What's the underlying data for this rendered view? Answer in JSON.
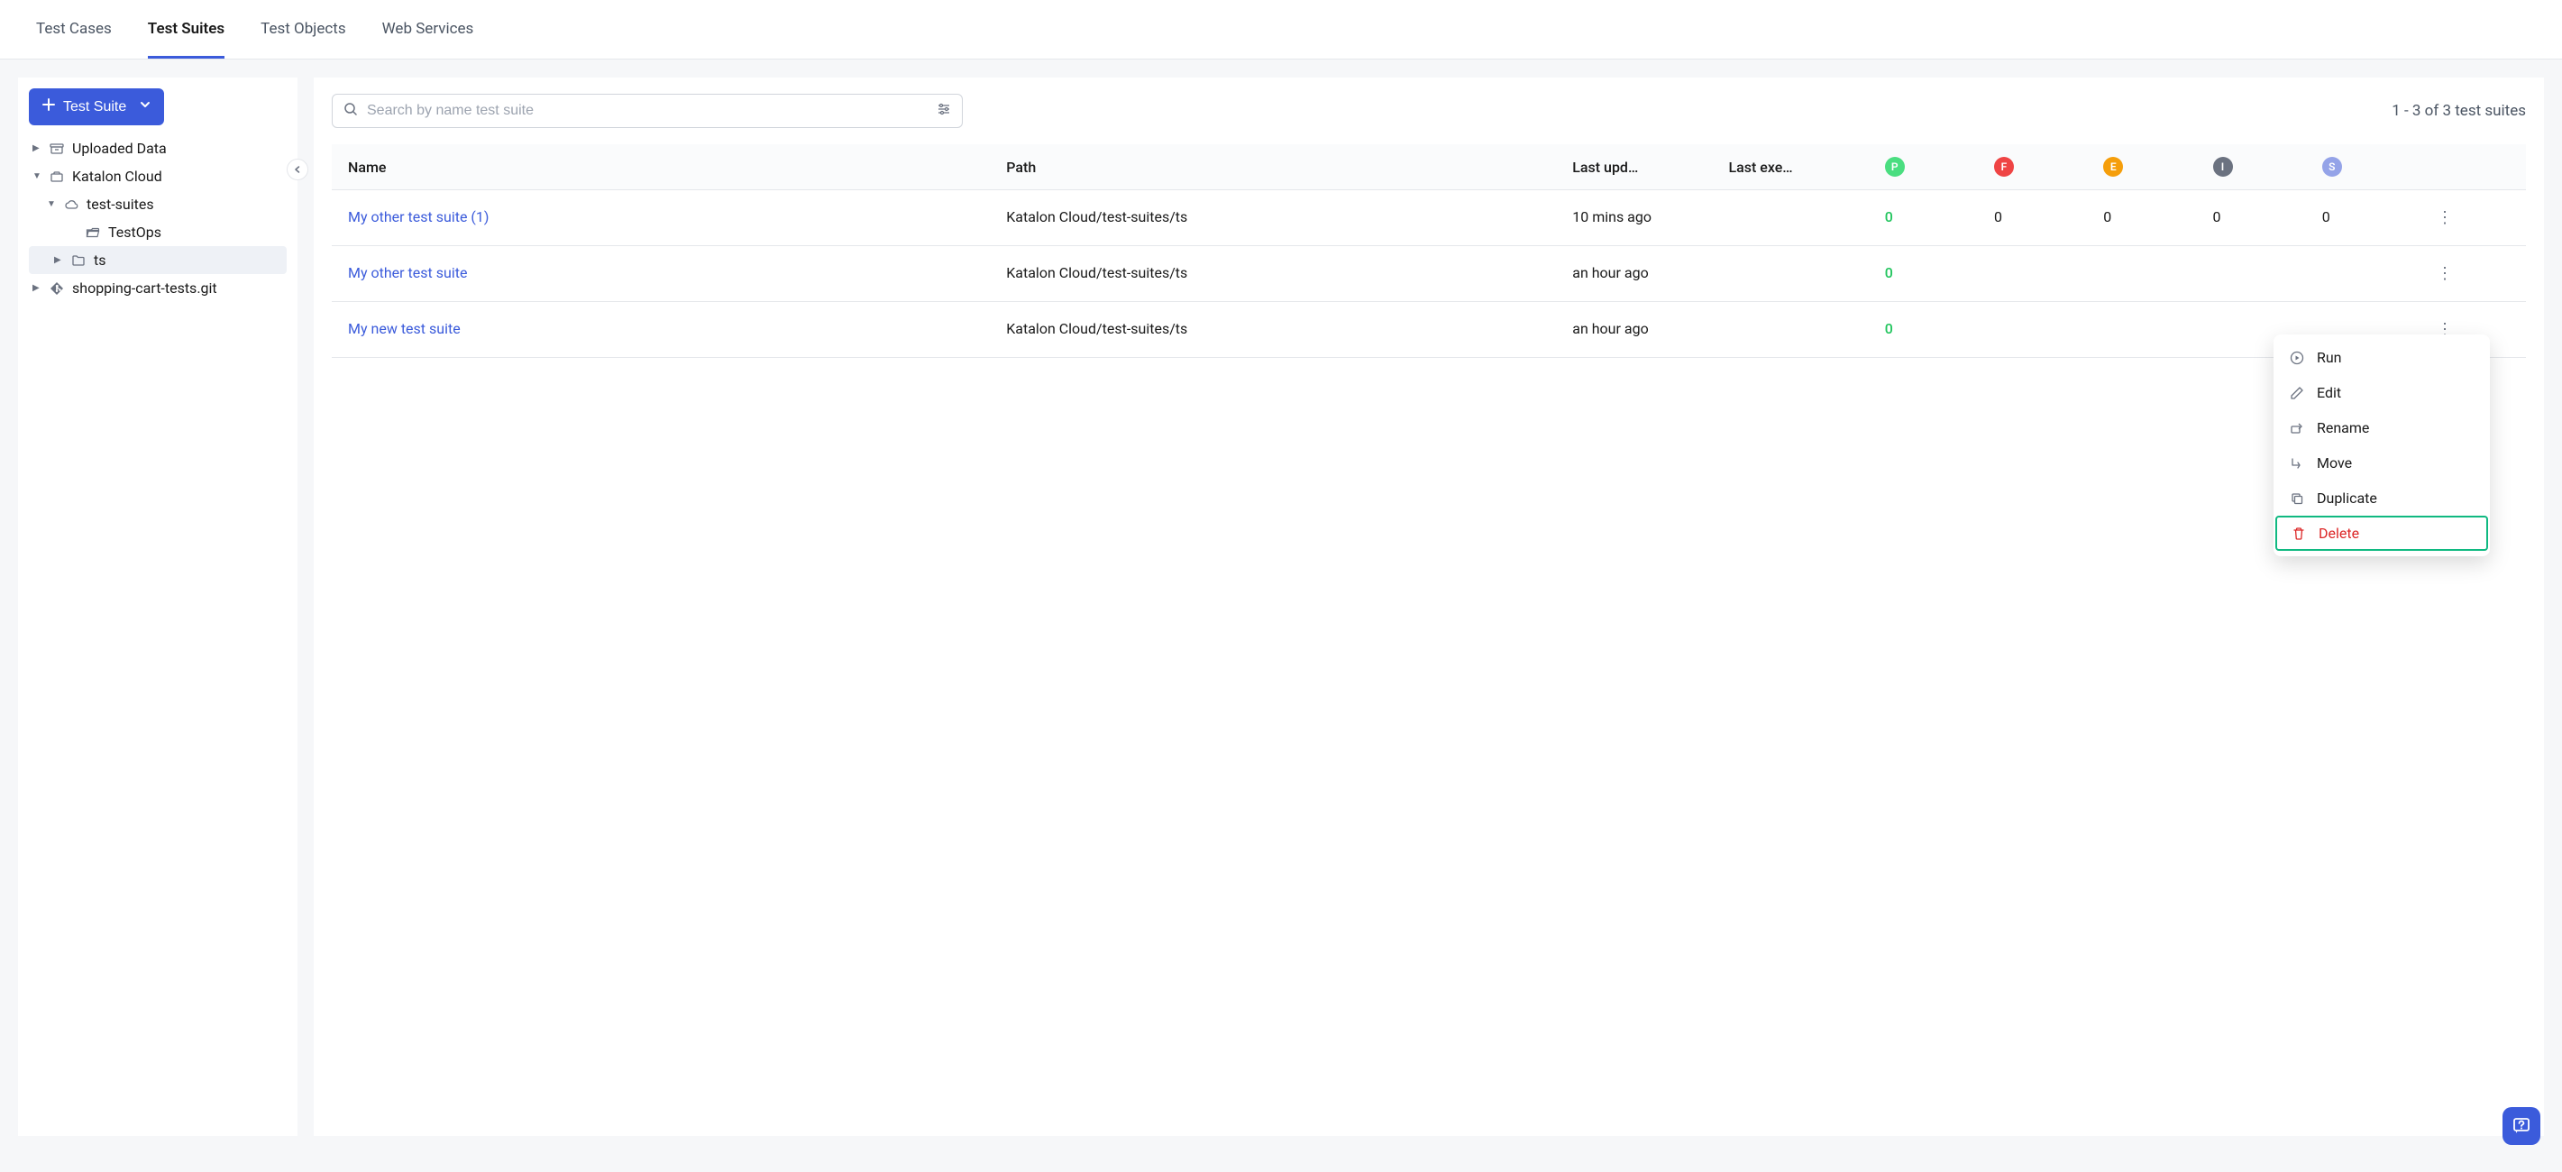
{
  "tabs": [
    {
      "label": "Test Cases",
      "active": false
    },
    {
      "label": "Test Suites",
      "active": true
    },
    {
      "label": "Test Objects",
      "active": false
    },
    {
      "label": "Web Services",
      "active": false
    }
  ],
  "sidebar": {
    "button_label": "Test Suite",
    "tree": {
      "uploaded_data": "Uploaded Data",
      "katalon_cloud": "Katalon Cloud",
      "test_suites": "test-suites",
      "testops": "TestOps",
      "ts": "ts",
      "shopping_cart": "shopping-cart-tests.git"
    }
  },
  "search": {
    "placeholder": "Search by name test suite"
  },
  "count_label": "1 - 3 of 3 test suites",
  "columns": {
    "name": "Name",
    "path": "Path",
    "last_upd": "Last upd…",
    "last_exe": "Last exe…",
    "p": "P",
    "f": "F",
    "e": "E",
    "i": "I",
    "s": "S"
  },
  "rows": [
    {
      "name": "My other test suite (1)",
      "path": "Katalon Cloud/test-suites/ts",
      "last_upd": "10 mins ago",
      "last_exe": "",
      "p": "0",
      "f": "0",
      "e": "0",
      "i": "0",
      "s": "0"
    },
    {
      "name": "My other test suite",
      "path": "Katalon Cloud/test-suites/ts",
      "last_upd": "an hour ago",
      "last_exe": "",
      "p": "0",
      "f": "",
      "e": "",
      "i": "",
      "s": ""
    },
    {
      "name": "My new test suite",
      "path": "Katalon Cloud/test-suites/ts",
      "last_upd": "an hour ago",
      "last_exe": "",
      "p": "0",
      "f": "",
      "e": "",
      "i": "",
      "s": ""
    }
  ],
  "context_menu": {
    "run": "Run",
    "edit": "Edit",
    "rename": "Rename",
    "move": "Move",
    "duplicate": "Duplicate",
    "delete": "Delete"
  }
}
